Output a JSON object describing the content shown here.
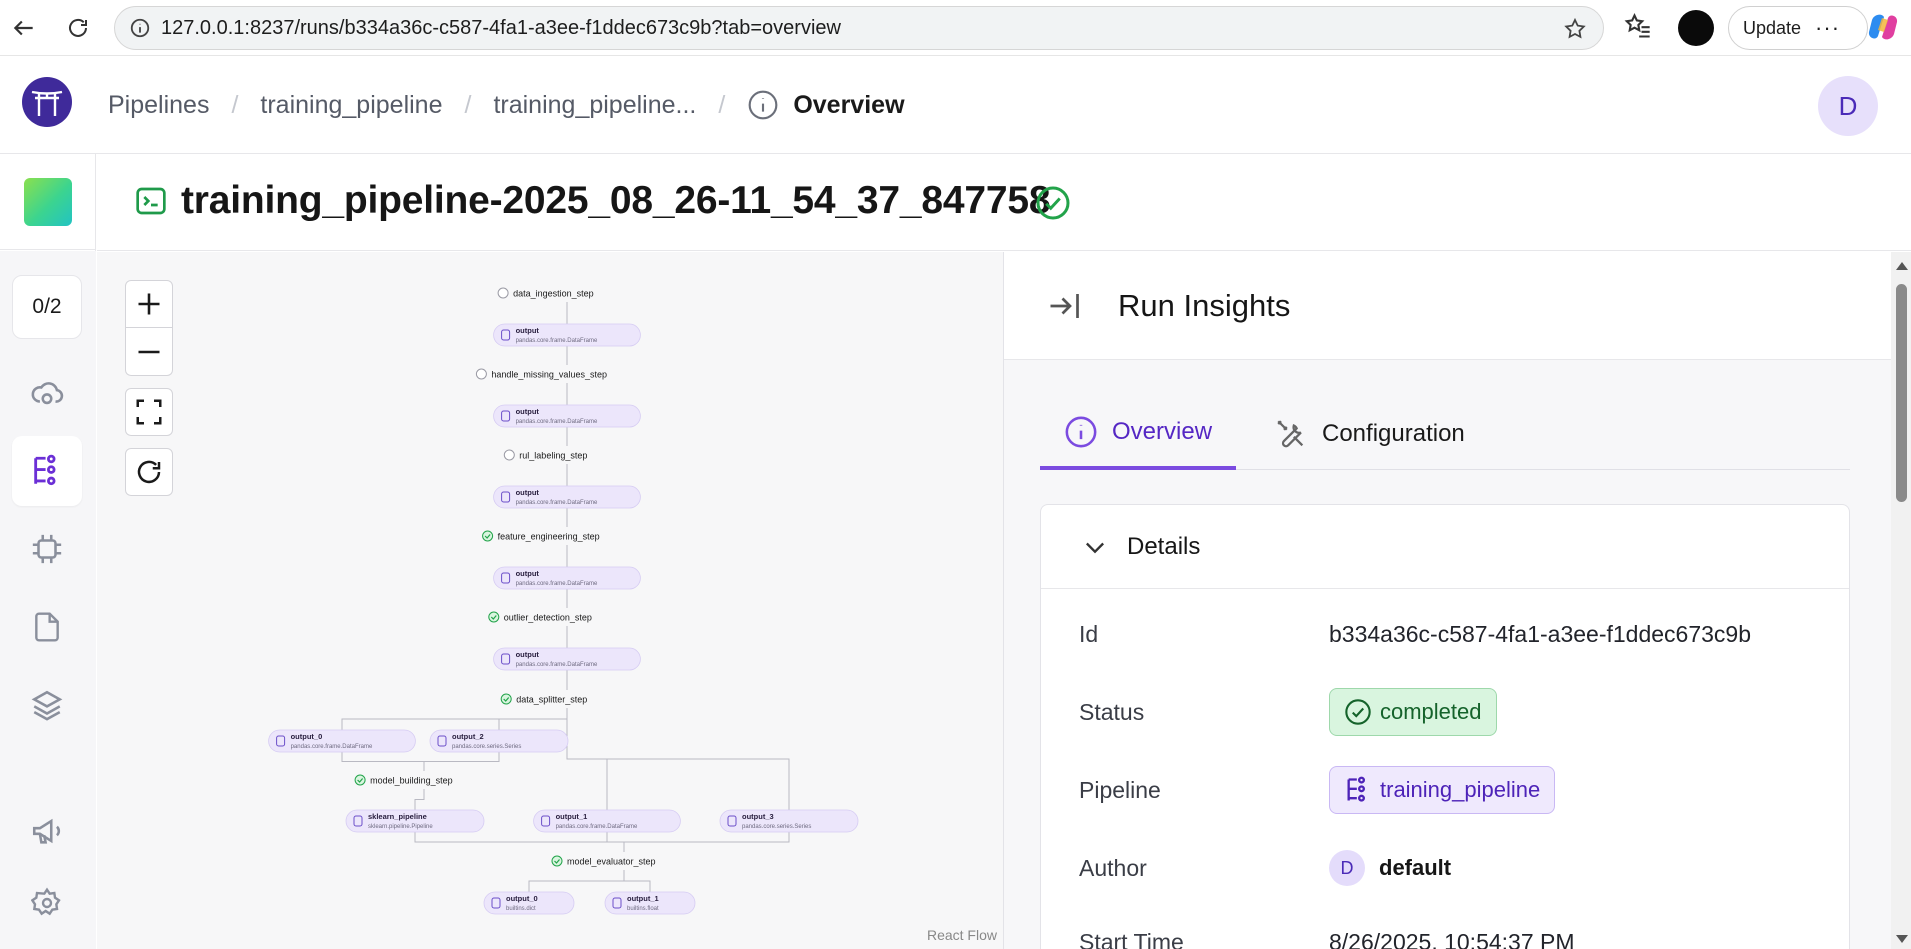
{
  "browser": {
    "url": "127.0.0.1:8237/runs/b334a36c-c587-4fa1-a3ee-f1ddec673c9b?tab=overview",
    "update_label": "Update"
  },
  "breadcrumbs": {
    "pipelines": "Pipelines",
    "pipeline": "training_pipeline",
    "run": "training_pipeline...",
    "current": "Overview"
  },
  "user_initial": "D",
  "run_title": "training_pipeline-2025_08_26-11_54_37_847758",
  "sidebar": {
    "counter": "0/2"
  },
  "dag": {
    "react_flow_label": "React Flow",
    "steps": [
      {
        "name": "data_ingestion_step",
        "status": "pending"
      },
      {
        "name": "handle_missing_values_step",
        "status": "pending"
      },
      {
        "name": "rul_labeling_step",
        "status": "pending"
      },
      {
        "name": "feature_engineering_step",
        "status": "completed"
      },
      {
        "name": "outlier_detection_step",
        "status": "completed"
      },
      {
        "name": "data_splitter_step",
        "status": "completed"
      },
      {
        "name": "model_building_step",
        "status": "completed"
      },
      {
        "name": "model_evaluator_step",
        "status": "completed"
      }
    ],
    "artifacts": [
      {
        "name": "output",
        "type": "pandas.core.frame.DataFrame"
      },
      {
        "name": "output",
        "type": "pandas.core.frame.DataFrame"
      },
      {
        "name": "output",
        "type": "pandas.core.frame.DataFrame"
      },
      {
        "name": "output",
        "type": "pandas.core.frame.DataFrame"
      },
      {
        "name": "output",
        "type": "pandas.core.frame.DataFrame"
      },
      {
        "name": "output_0",
        "type": "pandas.core.frame.DataFrame"
      },
      {
        "name": "output_2",
        "type": "pandas.core.series.Series"
      },
      {
        "name": "sklearn_pipeline",
        "type": "sklearn.pipeline.Pipeline"
      },
      {
        "name": "output_1",
        "type": "pandas.core.frame.DataFrame"
      },
      {
        "name": "output_3",
        "type": "pandas.core.series.Series"
      },
      {
        "name": "output_0",
        "type": "builtins.dict"
      },
      {
        "name": "output_1",
        "type": "builtins.float"
      }
    ]
  },
  "insights": {
    "title": "Run Insights",
    "tabs": [
      "Overview",
      "Configuration"
    ],
    "details_title": "Details",
    "rows": {
      "id_label": "Id",
      "id_value": "b334a36c-c587-4fa1-a3ee-f1ddec673c9b",
      "status_label": "Status",
      "status_value": "completed",
      "pipeline_label": "Pipeline",
      "pipeline_value": "training_pipeline",
      "author_label": "Author",
      "author_initial": "D",
      "author_value": "default",
      "start_label": "Start Time",
      "start_value": "8/26/2025, 10:54:37 PM"
    }
  },
  "colors": {
    "accent": "#7b4be0",
    "success": "#22a34a",
    "artifact": "#ece6fb"
  }
}
